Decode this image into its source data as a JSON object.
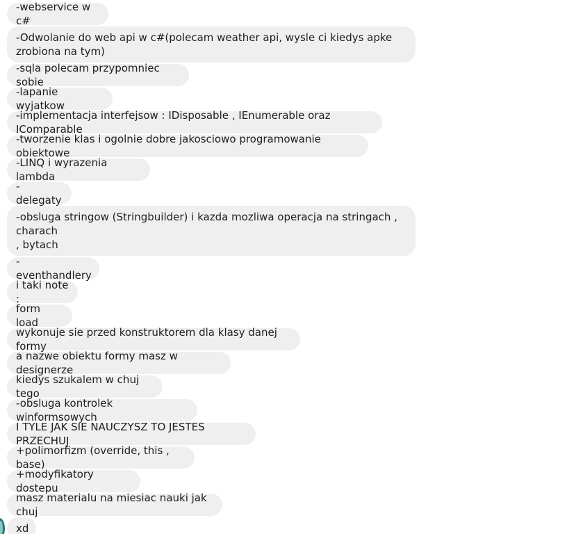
{
  "messages": [
    "-webservice w c#",
    "-Odwolanie do web api w c#(polecam weather api, wysle ci kiedys apke zrobiona na tym)",
    "-sqla polecam przypomniec sobie",
    "-lapanie wyjatkow",
    "-implementacja interfejsow : IDisposable , IEnumerable oraz IComparable",
    "-tworzenie klas i ogolnie dobre jakosciowo programowanie obiektowe",
    "-LINQ i wyrazenia lambda",
    "-delegaty",
    "-obsluga stringow (Stringbuilder) i kazda mozliwa operacja na stringach , charach\n, bytach",
    "-eventhandlery",
    "i taki note :",
    "form load",
    "wykonuje sie przed konstruktorem dla klasy danej formy",
    "a nazwe obiektu formy masz w designerze",
    "kiedys szukalem w chuj tego",
    "-obsluga kontrolek winformsowych",
    "I TYLE JAK SIE NAUCZYSZ TO JESTES PRZECHUJ",
    "+polimorfizm (override, this , base)",
    "+modyfikatory dostepu",
    "masz materialu na miesiac nauki jak chuj",
    "xd"
  ]
}
